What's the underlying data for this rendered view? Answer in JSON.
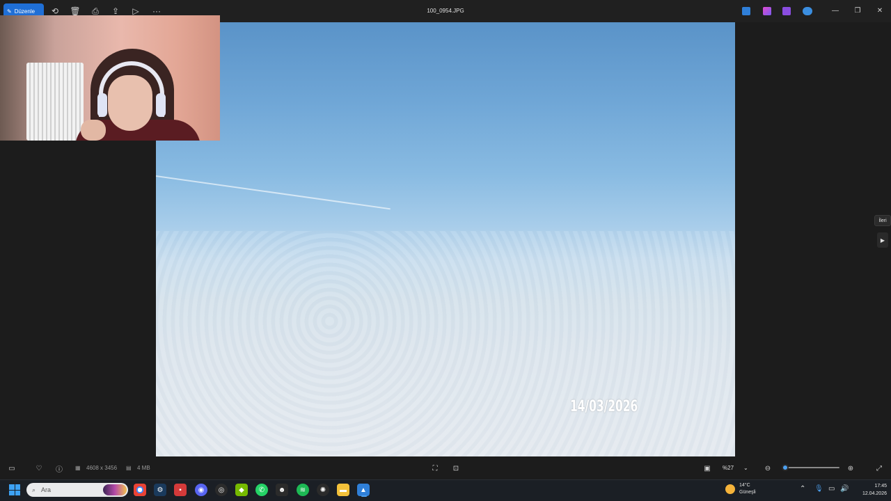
{
  "toolbar": {
    "edit_label": "Düzenle",
    "file_name": "100_0954.JPG"
  },
  "photo": {
    "date_stamp": "14/03/2026"
  },
  "navigation": {
    "next_tooltip": "İleri"
  },
  "status": {
    "dimensions": "4608 x 3456",
    "file_size": "4 MB",
    "zoom": "%27",
    "zoom_fraction": 0.05
  },
  "taskbar": {
    "search_placeholder": "Ara",
    "weather_temp": "14°C",
    "weather_desc": "Güneşli",
    "time": "17:45",
    "date": "12.04.2026"
  },
  "colors": {
    "accent": "#1f6fd6",
    "slider": "#4ca0f0"
  },
  "icons": [
    "edit-icon",
    "rotate-icon",
    "delete-icon",
    "print-icon",
    "share-icon",
    "slideshow-icon",
    "more-icon",
    "favorite-icon",
    "info-icon",
    "fit-icon",
    "zoom-out-icon",
    "zoom-in-icon",
    "fullscreen-icon"
  ]
}
